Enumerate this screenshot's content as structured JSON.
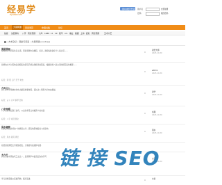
{
  "site": {
    "logo_text": "经易学",
    "logo_url": "eyuew.com"
  },
  "login": {
    "qq_button": "用QQ帐号登录",
    "username_label": "用户名",
    "password_label": "密码",
    "register_link": "立即注册",
    "forgot_link": "找回密码"
  },
  "nav": {
    "items": [
      {
        "label": "首页",
        "active": false
      },
      {
        "label": "大易网课",
        "active": true
      },
      {
        "label": "周易测算",
        "active": false
      },
      {
        "label": "命理书籍",
        "active": false
      },
      {
        "label": "论坛",
        "active": false
      }
    ]
  },
  "subbar": {
    "items": [
      "热搜",
      "免费算命",
      "八字",
      "周易预测",
      "六爻",
      "1988",
      "11",
      "29",
      "和平",
      "xm",
      "事业",
      "婚姻",
      "上海",
      "起名",
      "周易预测",
      "五术六艺"
    ]
  },
  "breadcrumb": {
    "text": "› 方术杂记 › 观察与问道 › 大易网课 (contraq)"
  },
  "threads": [
    {
      "title": "周易预测",
      "body": "论周易六爻研究生存之道，周易预测方法教程，论易，观察各种变化于人事之间......",
      "tags": "",
      "count": "0",
      "user": "易经大师",
      "date": "2023-10-30"
    },
    {
      "title": "",
      "body": "易经的六爻对天地自然相应的研究已经达到相当的程度，根据易经八卦之间的相互变化推理......",
      "tags": "标签：阴 阳 五行 天干 地支",
      "count": "0",
      "user": "admin",
      "date": "2023-10-30"
    },
    {
      "title": "六爻占卜",
      "body": "占卜在中华传统文化中占据着重要位置，通过占卜预测人的吉凶祸福.",
      "tags": "标签：占卜 六爻 纳甲 卦象",
      "count": "0",
      "user": "易学",
      "date": "2023-10-30"
    },
    {
      "title": "八字命理",
      "body": "八字命理学起源于唐代，以出生年月日时推算人的命运.",
      "tags": "标签：八字 命理 算命",
      "count": "0",
      "user": "命理",
      "date": "2023-10-30"
    },
    {
      "title": "风水堪舆",
      "body": "风水是中国古代的一种择居之学，研究地形地貌对人的影响.",
      "tags": "标签：风水 堪舆 择居",
      "count": "0",
      "user": "风水",
      "date": "2023-10-30"
    },
    {
      "title": "",
      "body": "易经讲究阴阳五行相生相克，万物皆有其规律可循.",
      "tags": "",
      "count": "",
      "user": "",
      "date": ""
    },
    {
      "title": "大六壬",
      "body": "大六壬是中国古代三式之一，是预测学中最高层次的学问.",
      "tags": "",
      "count": "0",
      "user": "六壬",
      "date": "2023-10-30"
    },
    {
      "title": "",
      "body": "学习易经需要从基础开始，循序渐进.",
      "tags": "",
      "count": "0",
      "user": "大易",
      "date": ""
    }
  ],
  "watermark": {
    "text": "链 接 SEO"
  },
  "colors": {
    "accent": "#f08c17",
    "watermark": "#0f6fb0"
  }
}
